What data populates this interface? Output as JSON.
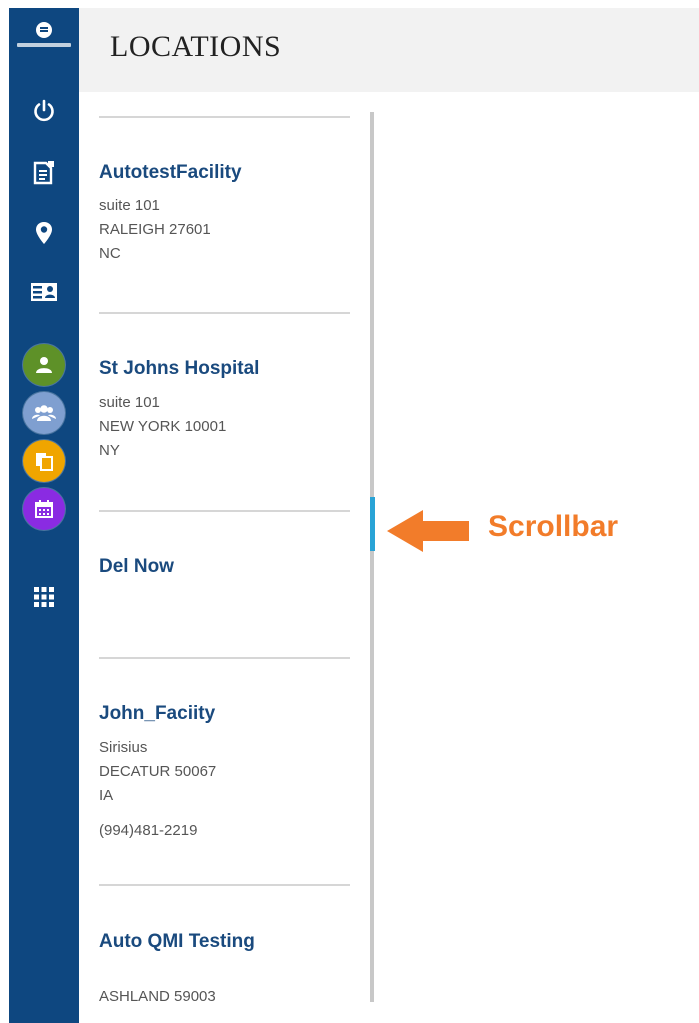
{
  "header": {
    "title": "LOCATIONS"
  },
  "sidebar": {
    "logo_icon": "konica-minolta-logo",
    "nav_icons": [
      "power-icon",
      "report-icon",
      "location-pin-icon",
      "id-card-icon"
    ],
    "apps": [
      {
        "icon": "user-icon",
        "color": "#5e9128"
      },
      {
        "icon": "users-icon",
        "color": "#7f9fd0"
      },
      {
        "icon": "copy-icon",
        "color": "#f0a500"
      },
      {
        "icon": "calendar-icon",
        "color": "#8a2be2"
      }
    ],
    "grid_icon": "grid-icon"
  },
  "locations": [
    {
      "name": "AutotestFacility",
      "line1": "suite 101",
      "line2": "RALEIGH  27601",
      "line3": "NC"
    },
    {
      "name": "St Johns Hospital",
      "line1": "suite 101",
      "line2": "NEW YORK  10001",
      "line3": "NY"
    },
    {
      "name": "Del Now"
    },
    {
      "name": "John_Faciity",
      "line1": "Sirisius",
      "line2": "DECATUR  50067",
      "line3": "IA",
      "phone": "(994)481-2219"
    },
    {
      "name": "Auto QMI Testing",
      "line2": "ASHLAND  59003"
    }
  ],
  "annotation": {
    "label": "Scrollbar",
    "color": "#f27c2a"
  },
  "colors": {
    "sidebar": "#0e4780",
    "accent": "#29a3d6",
    "link": "#1a4a7e"
  }
}
